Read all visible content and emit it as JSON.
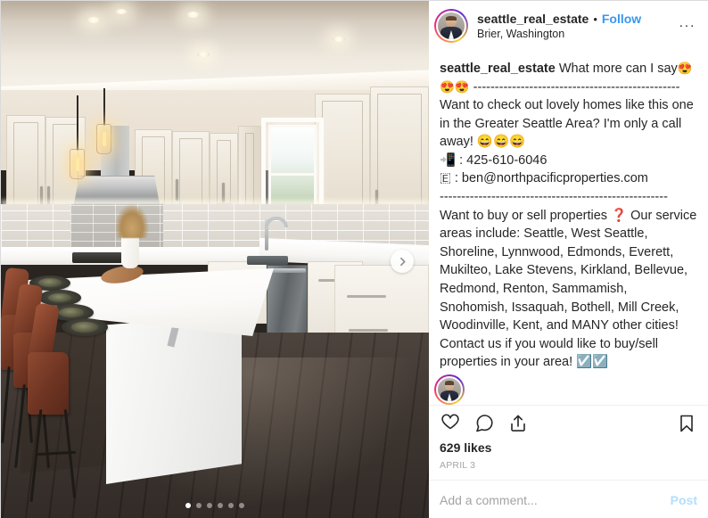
{
  "app": {
    "name": "Instagram",
    "platform": "instagram-post-desktop"
  },
  "colors": {
    "link_blue": "#3897f0",
    "post_disabled_blue": "#b2dffc",
    "text_primary": "#262626",
    "text_muted": "#a6a6a6",
    "border": "#dbdbdb",
    "question_red": "#d62828"
  },
  "header": {
    "username": "seattle_real_estate",
    "separator": "•",
    "follow_label": "Follow",
    "location": "Brier, Washington",
    "more_options": "...",
    "avatar_alt": "seattle_real_estate profile photo"
  },
  "media": {
    "type": "carousel",
    "alt": "Modern kitchen with white shaker cabinets, quartz island, leather barstools and dark hardwood floor",
    "slide_count": 6,
    "active_slide": 1,
    "next_label": "Next",
    "dots": [
      true,
      false,
      false,
      false,
      false,
      false
    ]
  },
  "caption": {
    "username": "seattle_real_estate",
    "lines": [
      {
        "text": "What more can I say",
        "emoji": "😍😍😍",
        "bold_user": true
      },
      {
        "text": "------------------------------------------------"
      },
      {
        "text": "Want to check out lovely homes like this one in the Greater Seattle Area? I'm only a call away! 😄😄😄"
      },
      {
        "text": "📲 : 425-610-6046"
      },
      {
        "text": "🇪 : ben@northpacificproperties.com"
      },
      {
        "text": "-----------------------------------------------------"
      },
      {
        "text": "Want to buy or sell properties ❓ Our service areas include: Seattle, West Seattle, Shoreline, Lynnwood, Edmonds, Everett, Mukilteo, Lake Stevens, Kirkland, Bellevue, Redmond, Renton, Sammamish, Snohomish, Issaquah, Bothell, Mill Creek, Woodinville, Kent, and MANY other cities! Contact us if you would like to buy/sell properties in your area! ☑️☑️"
      }
    ],
    "phone": "425-610-6046",
    "email": "ben@northpacificproperties.com",
    "service_areas": [
      "Seattle",
      "West Seattle",
      "Shoreline",
      "Lynnwood",
      "Edmonds",
      "Everett",
      "Mukilteo",
      "Lake Stevens",
      "Kirkland",
      "Bellevue",
      "Redmond",
      "Renton",
      "Sammamish",
      "Snohomish",
      "Issaquah",
      "Bothell",
      "Mill Creek",
      "Woodinville",
      "Kent"
    ]
  },
  "actions": {
    "like_icon": "heart-icon",
    "comment_icon": "comment-icon",
    "share_icon": "share-icon",
    "save_icon": "bookmark-icon",
    "likes_text": "629 likes",
    "likes_count": 629,
    "date": "APRIL 3"
  },
  "add_comment": {
    "placeholder": "Add a comment...",
    "value": "",
    "post_label": "Post"
  }
}
